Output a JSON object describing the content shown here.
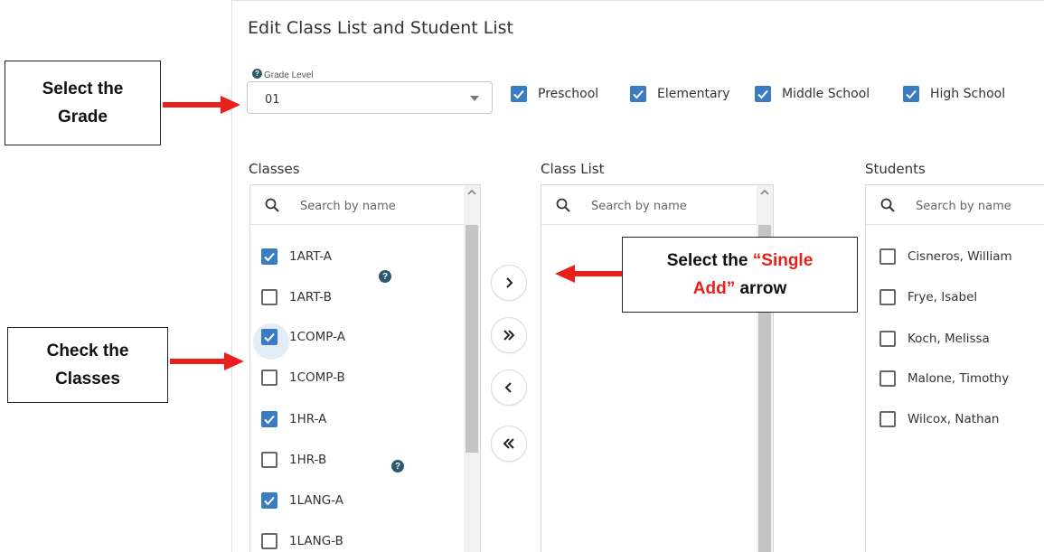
{
  "page": {
    "title": "Edit Class List and Student List"
  },
  "grade": {
    "label": "Grade Level",
    "help_icon": "question-circle-icon",
    "value": "01"
  },
  "levels": [
    {
      "label": "Preschool",
      "checked": true
    },
    {
      "label": "Elementary",
      "checked": true
    },
    {
      "label": "Middle School",
      "checked": true
    },
    {
      "label": "High School",
      "checked": true
    }
  ],
  "classes": {
    "title": "Classes",
    "search_placeholder": "Search by name",
    "items": [
      {
        "label": "1ART-A",
        "checked": true
      },
      {
        "label": "1ART-B",
        "checked": false
      },
      {
        "label": "1COMP-A",
        "checked": true,
        "focused": true
      },
      {
        "label": "1COMP-B",
        "checked": false
      },
      {
        "label": "1HR-A",
        "checked": true
      },
      {
        "label": "1HR-B",
        "checked": false
      },
      {
        "label": "1LANG-A",
        "checked": true
      },
      {
        "label": "1LANG-B",
        "checked": false
      }
    ]
  },
  "class_list": {
    "title": "Class List",
    "search_placeholder": "Search by name",
    "items": []
  },
  "students": {
    "title": "Students",
    "search_placeholder": "Search by name",
    "items": [
      {
        "label": "Cisneros, William",
        "checked": false
      },
      {
        "label": "Frye, Isabel",
        "checked": false
      },
      {
        "label": "Koch, Melissa",
        "checked": false
      },
      {
        "label": "Malone, Timothy",
        "checked": false
      },
      {
        "label": "Wilcox, Nathan",
        "checked": false
      }
    ]
  },
  "transfer_buttons": [
    {
      "icon": "chevron-right-icon",
      "action": "single add"
    },
    {
      "icon": "double-chevron-right-icon",
      "action": "add all"
    },
    {
      "icon": "chevron-left-icon",
      "action": "single remove"
    },
    {
      "icon": "double-chevron-left-icon",
      "action": "remove all"
    }
  ],
  "annotations": {
    "grade": {
      "line1": "Select the",
      "line2": "Grade"
    },
    "classes": {
      "line1": "Check the",
      "line2": "Classes"
    },
    "single_add": {
      "line1_black": "Select the ",
      "line1_red": "“Single",
      "line2_red": "Add”",
      "line2_black": " arrow"
    }
  },
  "colors": {
    "checkbox": "#3a7cc3",
    "annotation_arrow": "#e8201c",
    "annotation_highlight": "#e8201c",
    "help_badge": "#2e5a6e"
  }
}
